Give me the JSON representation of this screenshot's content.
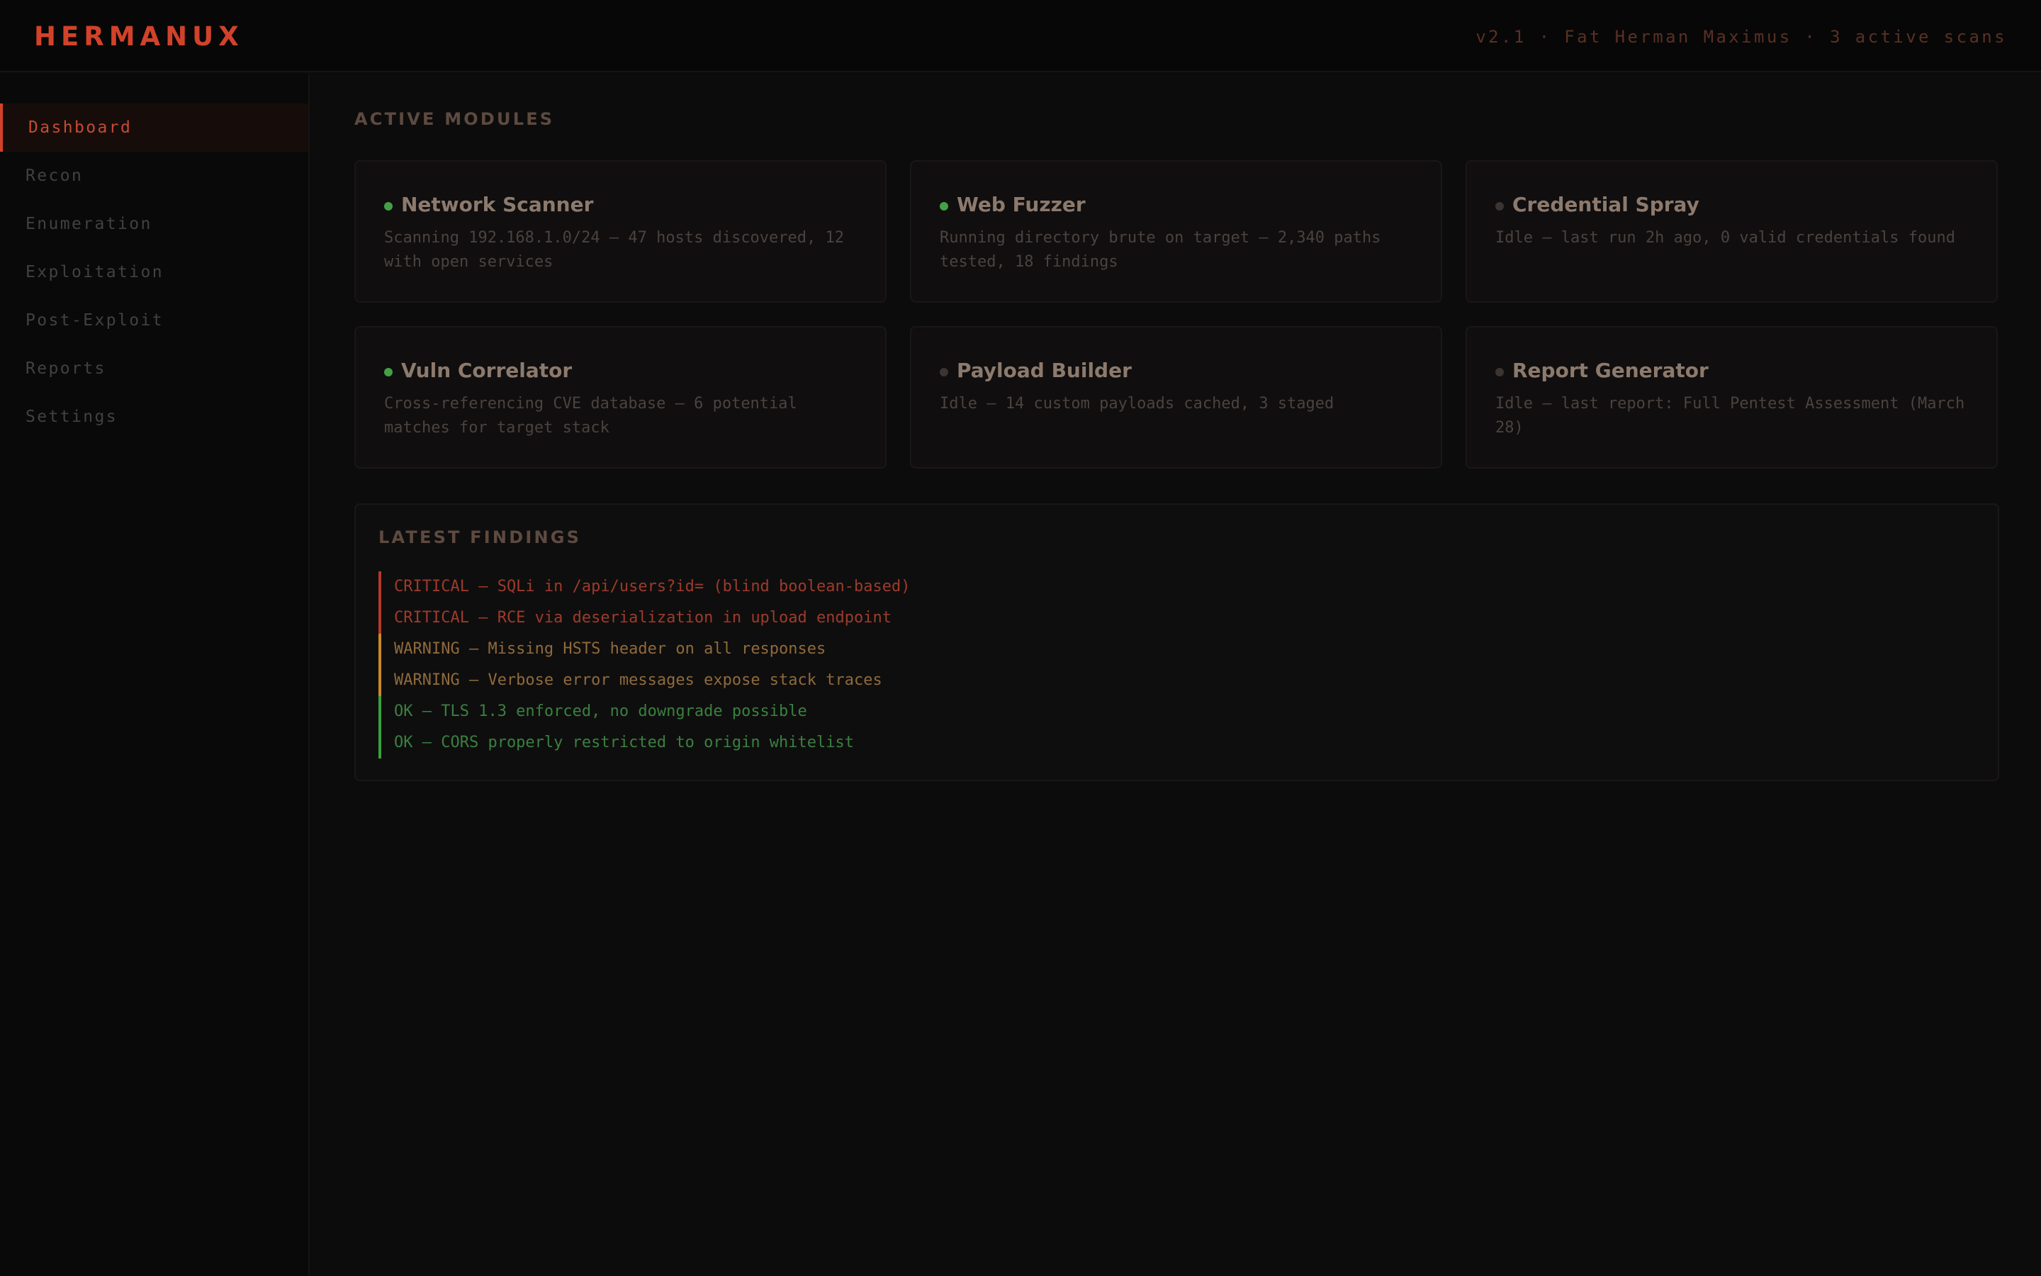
{
  "header": {
    "brand": "HERMANUX",
    "status": "v2.1 · Fat Herman Maximus · 3 active scans"
  },
  "sidebar": {
    "items": [
      {
        "label": "Dashboard",
        "active": true
      },
      {
        "label": "Recon"
      },
      {
        "label": "Enumeration"
      },
      {
        "label": "Exploitation"
      },
      {
        "label": "Post-Exploit"
      },
      {
        "label": "Reports"
      },
      {
        "label": "Settings"
      }
    ]
  },
  "modules": {
    "title": "ACTIVE MODULES",
    "items": [
      {
        "name": "Network Scanner",
        "status": "active",
        "desc": "Scanning 192.168.1.0/24 — 47 hosts discovered, 12 with open services"
      },
      {
        "name": "Web Fuzzer",
        "status": "active",
        "desc": "Running directory brute on target — 2,340 paths tested, 18 findings"
      },
      {
        "name": "Credential Spray",
        "status": "idle",
        "desc": "Idle — last run 2h ago, 0 valid credentials found"
      },
      {
        "name": "Vuln Correlator",
        "status": "active",
        "desc": "Cross-referencing CVE database — 6 potential matches for target stack"
      },
      {
        "name": "Payload Builder",
        "status": "idle",
        "desc": "Idle — 14 custom payloads cached, 3 staged"
      },
      {
        "name": "Report Generator",
        "status": "idle",
        "desc": "Idle — last report: Full Pentest Assessment (March 28)"
      }
    ]
  },
  "findings": {
    "title": "LATEST FINDINGS",
    "items": [
      {
        "severity": "critical",
        "text": "CRITICAL — SQLi in /api/users?id= (blind boolean-based)"
      },
      {
        "severity": "critical",
        "text": "CRITICAL — RCE via deserialization in upload endpoint"
      },
      {
        "severity": "warning",
        "text": "WARNING — Missing HSTS header on all responses"
      },
      {
        "severity": "warning",
        "text": "WARNING — Verbose error messages expose stack traces"
      },
      {
        "severity": "ok",
        "text": "OK — TLS 1.3 enforced, no downgrade possible"
      },
      {
        "severity": "ok",
        "text": "OK — CORS properly restricted to origin whitelist"
      }
    ]
  },
  "colors": {
    "accent": "#d2422a",
    "active_dot": "#43a047",
    "idle_dot": "#3a3532",
    "critical": "#b53a26",
    "warning": "#c98a2a",
    "ok": "#3aa03f"
  }
}
